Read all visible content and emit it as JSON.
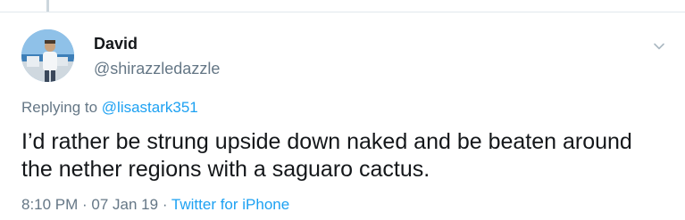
{
  "tweet": {
    "author": {
      "display_name": "David",
      "handle": "@shirazzledazzle"
    },
    "reply_context": {
      "prefix": "Replying to ",
      "mention": "@lisastark351"
    },
    "text": "I’d rather be strung upside down naked and be beaten around the nether regions with a saguaro cactus.",
    "meta": {
      "time": "8:10 PM",
      "separator": " · ",
      "date": "07 Jan 19",
      "source": "Twitter for iPhone"
    },
    "icons": {
      "menu": "chevron-down-icon"
    },
    "colors": {
      "link": "#1da1f2",
      "secondary_text": "#657786",
      "primary_text": "#14171a",
      "divider": "#e1e8ed"
    }
  }
}
